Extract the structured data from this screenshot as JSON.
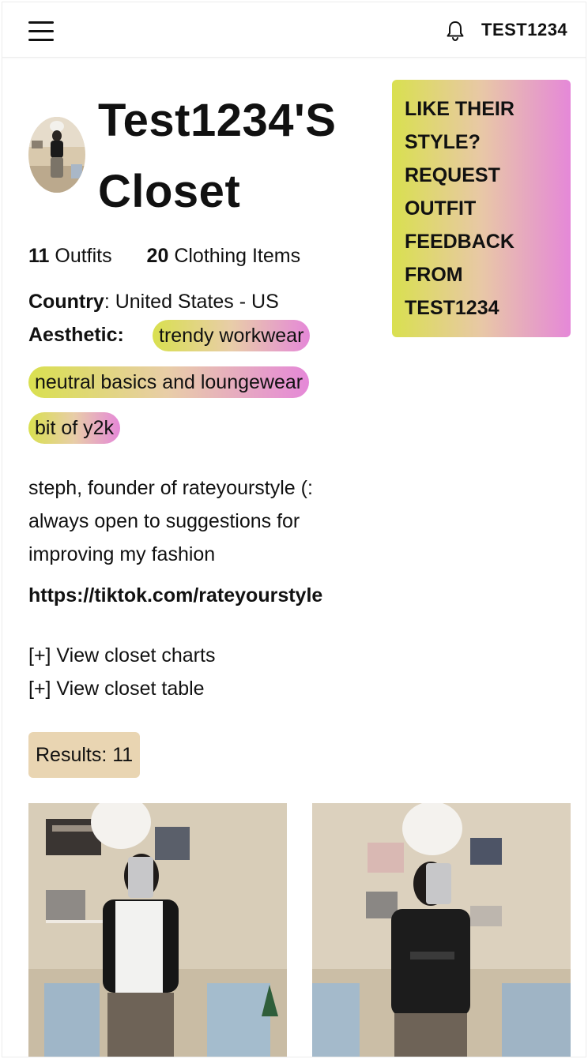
{
  "header": {
    "username": "TEST1234"
  },
  "profile": {
    "title_line1": "Test1234'S",
    "title_line2": "Closet",
    "outfits_count": "11",
    "outfits_label": "Outfits",
    "items_count": "20",
    "items_label": "Clothing Items",
    "country_label": "Country",
    "country_value": ": United States - US",
    "aesthetic_label": "Aesthetic:",
    "aesthetics": [
      "trendy workwear",
      "neutral basics and loungewear",
      "bit of y2k"
    ],
    "bio_lines": [
      "steph, founder of rateyourstyle (:",
      "always open to suggestions for",
      "improving my fashion"
    ],
    "link": "https://tiktok.com/rateyourstyle"
  },
  "cta": {
    "lines": [
      "LIKE THEIR",
      "STYLE?",
      "REQUEST",
      "OUTFIT",
      "FEEDBACK",
      "FROM",
      "TEST1234"
    ]
  },
  "toggles": {
    "charts": "[+] View closet charts",
    "table": "[+] View closet table"
  },
  "results": {
    "label": "Results: 11"
  },
  "colors": {
    "gradient_start": "#d9e04f",
    "gradient_mid": "#e8cda8",
    "gradient_end": "#e588d8",
    "results_bg": "#e9d5b2"
  },
  "icons": {
    "menu": "hamburger-menu-icon",
    "notifications": "bell-icon"
  }
}
